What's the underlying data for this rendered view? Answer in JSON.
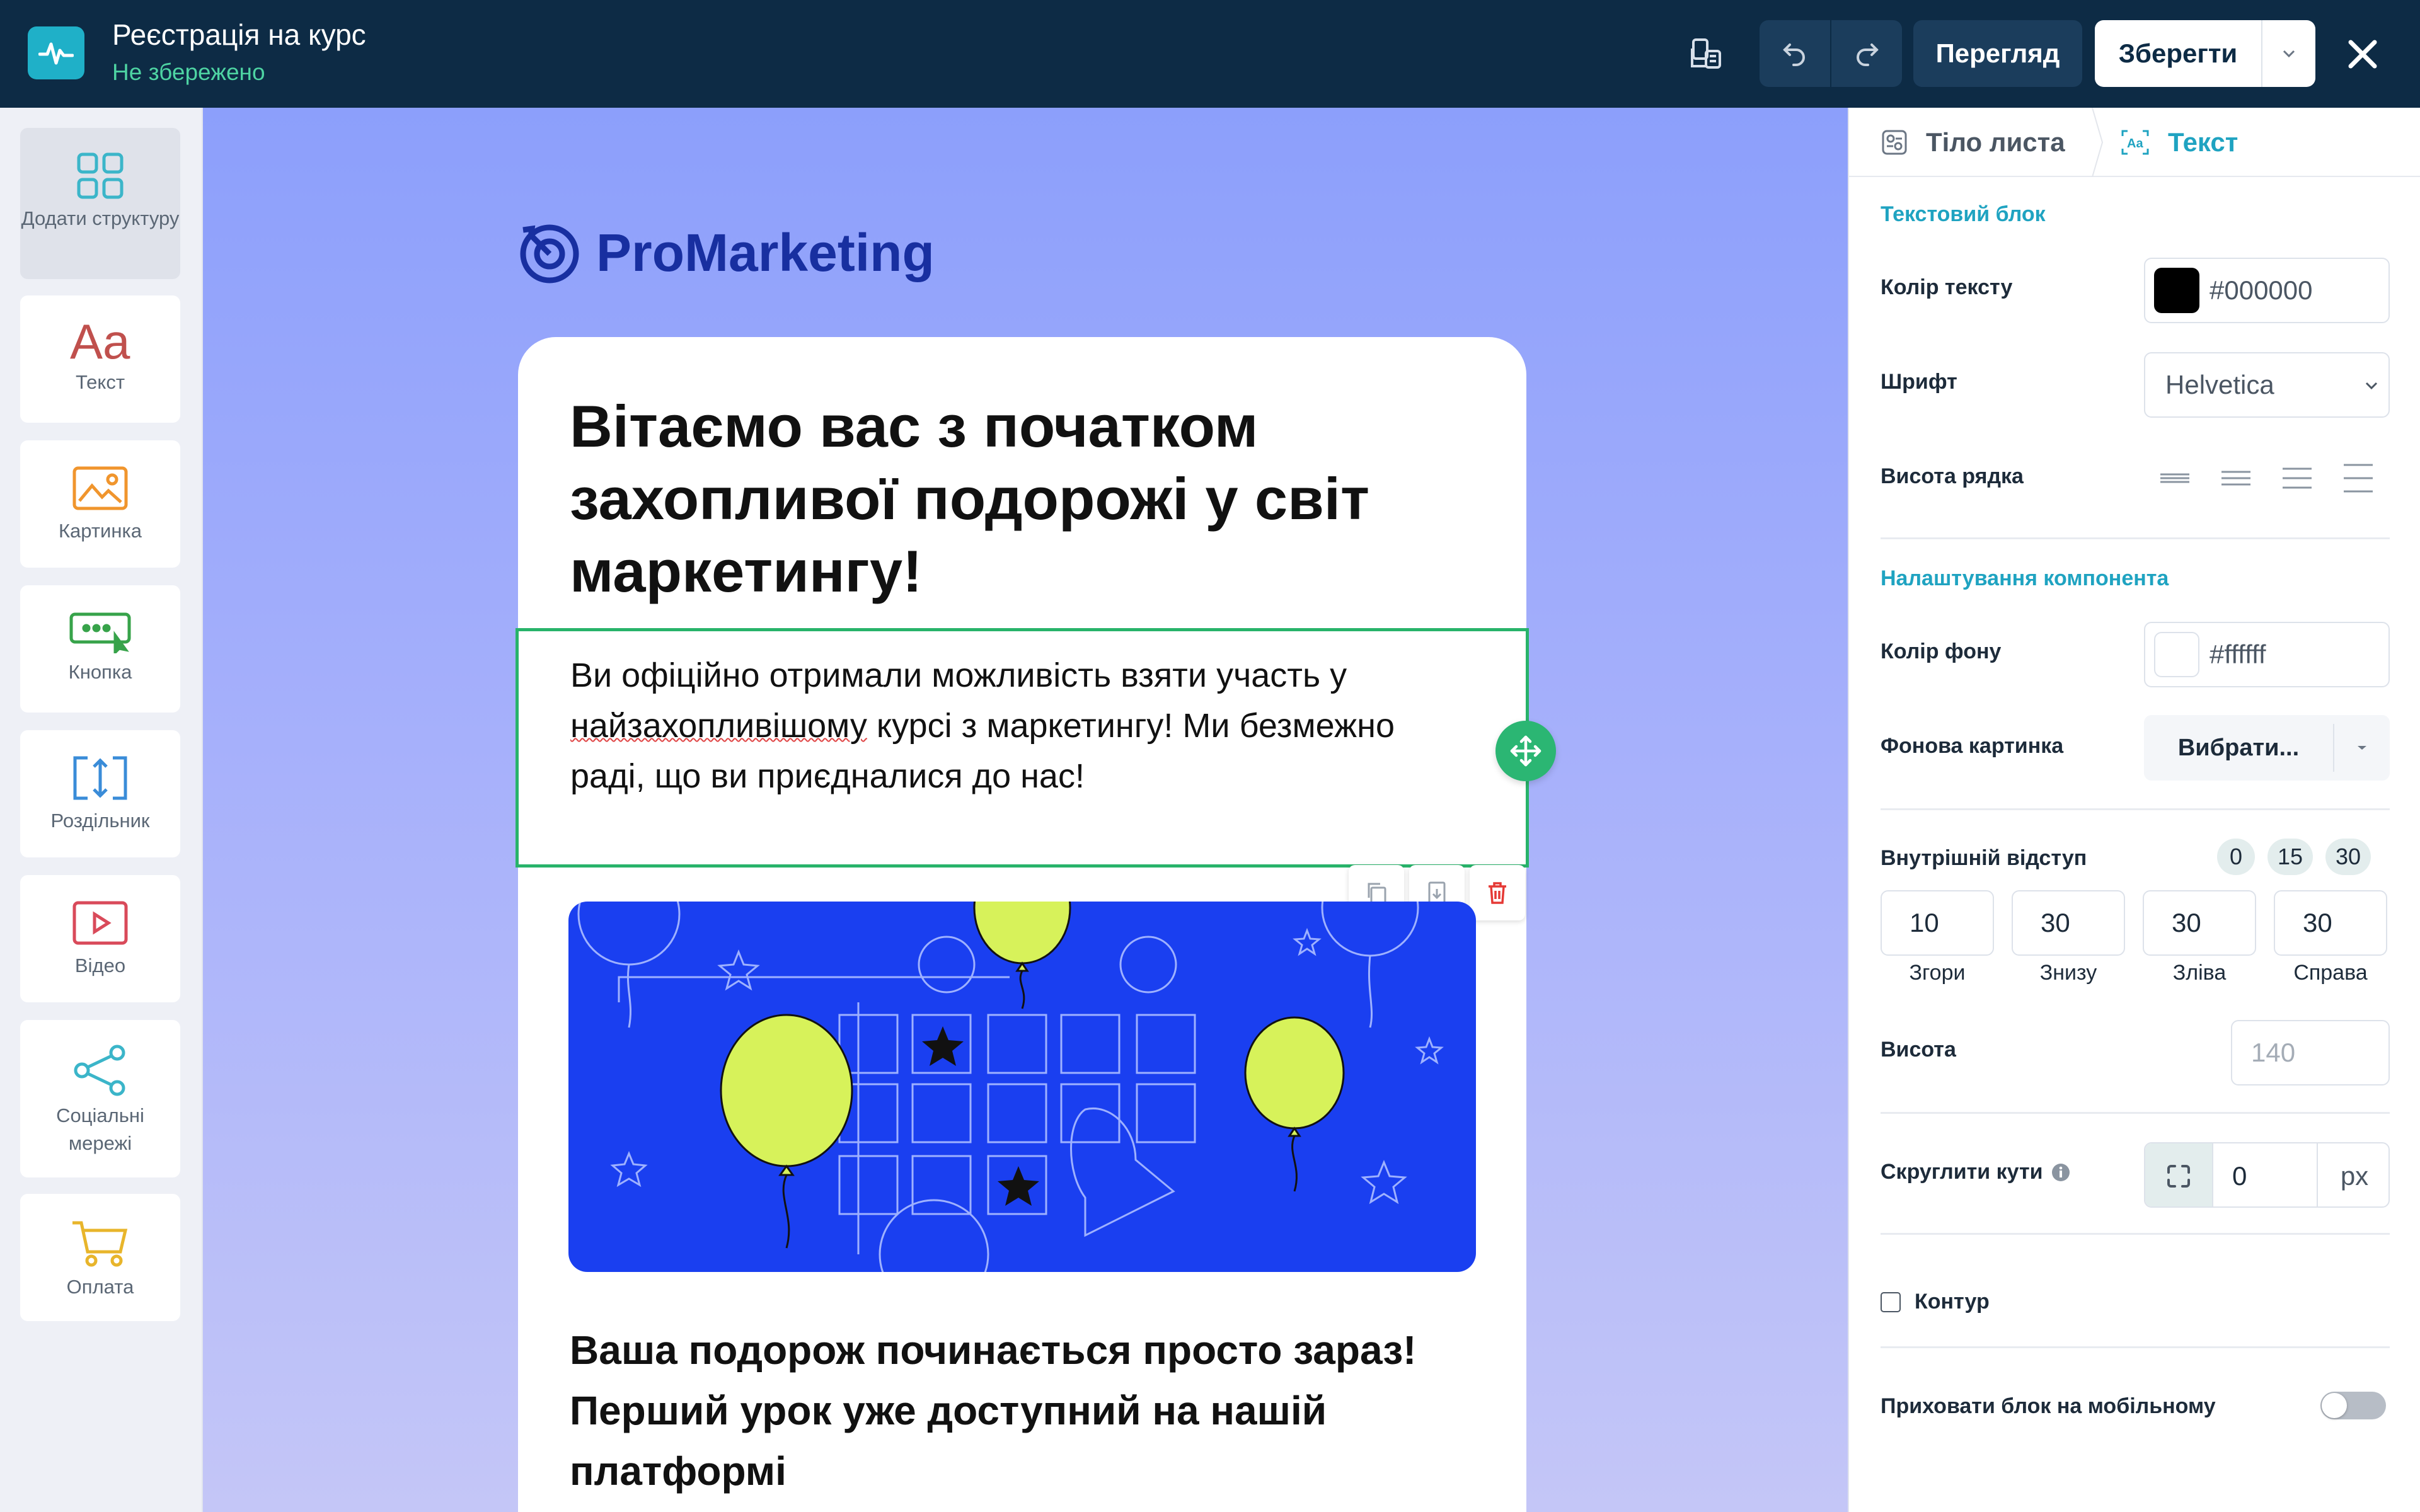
{
  "app": {
    "title": "Реєстрація на курс",
    "status": "Не збережено"
  },
  "toolbar": {
    "preview_label": "Перегляд",
    "save_label": "Зберегти"
  },
  "sidebar": {
    "items": [
      {
        "label": "Додати структуру",
        "icon": "grid-icon",
        "color": "#3bb5c9"
      },
      {
        "label": "Текст",
        "icon": "text-aa-icon",
        "color": "#c0504d"
      },
      {
        "label": "Картинка",
        "icon": "image-icon",
        "color": "#f0952d"
      },
      {
        "label": "Кнопка",
        "icon": "button-icon",
        "color": "#37a34a"
      },
      {
        "label": "Роздільник",
        "icon": "divider-icon",
        "color": "#3a8cd8"
      },
      {
        "label": "Відео",
        "icon": "video-icon",
        "color": "#d94a5a"
      },
      {
        "label": "Соціальні мережі",
        "icon": "share-icon",
        "color": "#3bb5c9"
      },
      {
        "label": "Оплата",
        "icon": "cart-icon",
        "color": "#e8b52b"
      }
    ]
  },
  "email": {
    "brand": "ProMarketing",
    "headline": "Вітаємо вас з початком захопливої подорожі у світ маркетингу!",
    "paragraph_part1": "Ви офіційно отримали можливість взяти участь у ",
    "paragraph_squiggle": "найзахопливішому",
    "paragraph_part2": " курсі з маркетингу! Ми безмежно раді, що ви приєдналися до нас!",
    "subhead": "Ваша подорож починається просто зараз! Перший урок уже доступний на нашій платформі"
  },
  "panel": {
    "tabs": [
      {
        "label": "Тіло листа",
        "icon": "body-settings-icon"
      },
      {
        "label": "Текст",
        "icon": "text-settings-icon"
      }
    ],
    "text_block": {
      "title": "Текстовий блок",
      "text_color_label": "Колір тексту",
      "text_color_value": "#000000",
      "font_label": "Шрифт",
      "font_value": "Helvetica",
      "line_height_label": "Висота рядка"
    },
    "component": {
      "title": "Налаштування компонента",
      "bg_color_label": "Колір фону",
      "bg_color_value": "#ffffff",
      "bg_image_label": "Фонова картинка",
      "bg_image_button": "Вибрати...",
      "padding_label": "Внутрішній відступ",
      "padding_presets": [
        "0",
        "15",
        "30"
      ],
      "padding_values": [
        {
          "value": "10",
          "label": "Згори"
        },
        {
          "value": "30",
          "label": "Знизу"
        },
        {
          "value": "30",
          "label": "Зліва"
        },
        {
          "value": "30",
          "label": "Справа"
        }
      ],
      "height_label": "Висота",
      "height_placeholder": "140",
      "radius_label": "Скруглити кути",
      "radius_value": "0",
      "radius_unit": "px",
      "outline_label": "Контур",
      "hide_mobile_label": "Приховати блок на мобільному"
    }
  },
  "colors": {
    "topbar": "#0d2b45",
    "accent": "#1fa3c1",
    "selection": "#28b36a",
    "banner": "#1a3ff0",
    "balloon": "#d7f25a"
  }
}
